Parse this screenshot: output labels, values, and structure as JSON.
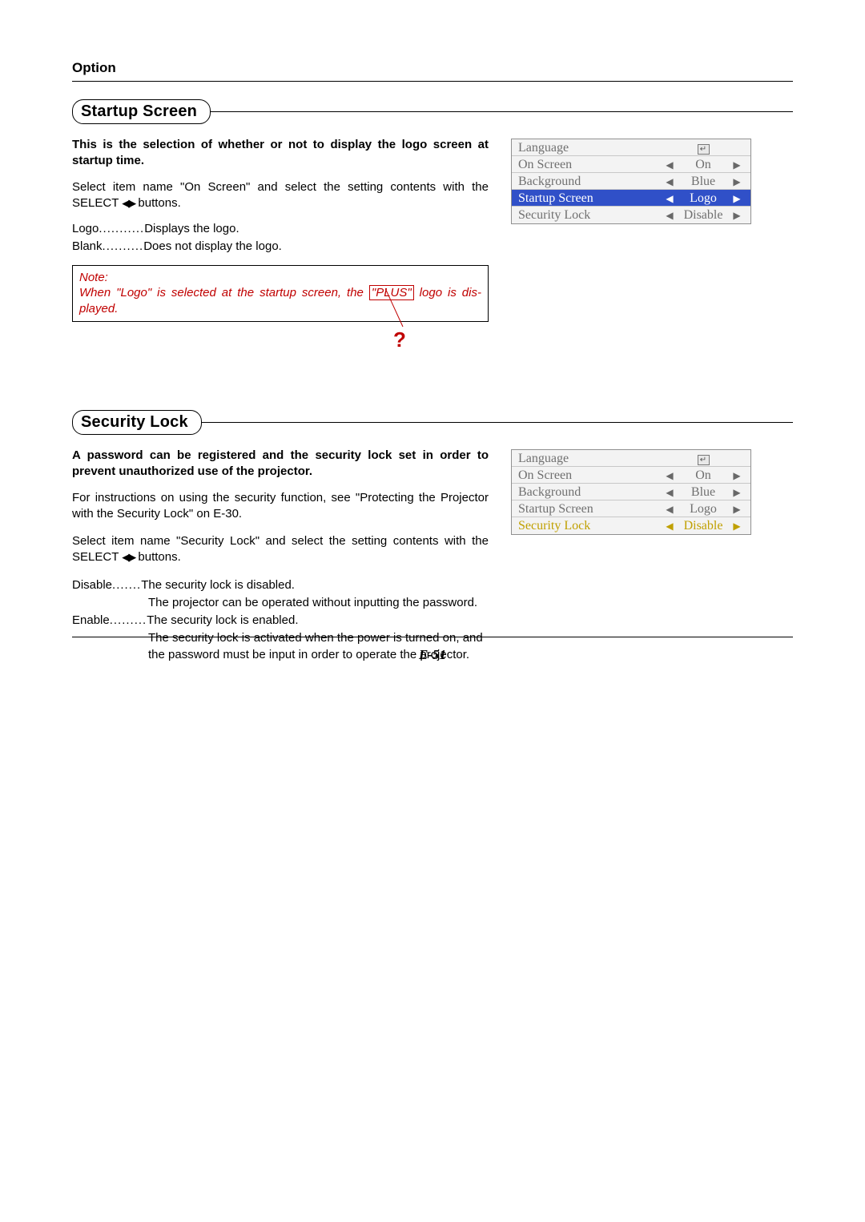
{
  "header": {
    "title": "Option"
  },
  "sections": {
    "startup": {
      "title": "Startup Screen",
      "intro": "This is the selection of whether or not to display the logo screen at startup time.",
      "body_a": "Select item name \"On Screen\" and select the setting contents with the SELECT ",
      "body_b": " buttons.",
      "arrows_glyph": "◀▶",
      "opts": {
        "logo_term": "Logo",
        "logo_dots": " ........... ",
        "logo_desc": "Displays the logo.",
        "blank_term": "Blank",
        "blank_dots": " .......... ",
        "blank_desc": "Does not display the logo."
      },
      "note": {
        "title": "Note:",
        "pre": "When \"Logo\" is selected at the startup screen, the ",
        "boxed": "\"PLUS\"",
        "post": " logo is dis-played.",
        "qmark": "?"
      },
      "menu": {
        "rows": [
          {
            "label": "Language",
            "value": "",
            "icon": true,
            "arrows": false,
            "hl": ""
          },
          {
            "label": "On Screen",
            "value": "On",
            "arrows": true,
            "hl": ""
          },
          {
            "label": "Background",
            "value": "Blue",
            "arrows": true,
            "hl": ""
          },
          {
            "label": "Startup Screen",
            "value": "Logo",
            "arrows": true,
            "hl": "blue"
          },
          {
            "label": "Security Lock",
            "value": "Disable",
            "arrows": true,
            "hl": ""
          }
        ]
      }
    },
    "security": {
      "title": "Security Lock",
      "intro": "A password can be registered and the security lock set in order to prevent unauthorized use of the projector.",
      "body1": "For instructions on using the security function, see \"Protecting the Projector with the Security Lock\" on E-30.",
      "body2_a": "Select item name \"Security Lock\" and select the setting contents with the SELECT ",
      "body2_b": " buttons.",
      "arrows_glyph": "◀▶",
      "opts": {
        "disable_term": "Disable",
        "disable_dots": " ....... ",
        "disable_desc": "The security lock is disabled.",
        "disable_more": "The projector can be operated without inputting the password.",
        "enable_term": "Enable",
        "enable_dots": " ......... ",
        "enable_desc": "The security lock is enabled.",
        "enable_more1": "The security lock is activated when the power is turned on, and the password must be input in order to operate the projector."
      },
      "menu": {
        "rows": [
          {
            "label": "Language",
            "value": "",
            "icon": true,
            "arrows": false,
            "hl": ""
          },
          {
            "label": "On Screen",
            "value": "On",
            "arrows": true,
            "hl": ""
          },
          {
            "label": "Background",
            "value": "Blue",
            "arrows": true,
            "hl": ""
          },
          {
            "label": "Startup Screen",
            "value": "Logo",
            "arrows": true,
            "hl": ""
          },
          {
            "label": "Security Lock",
            "value": "Disable",
            "arrows": true,
            "hl": "yellow"
          }
        ]
      }
    }
  },
  "page_number": "E-51"
}
